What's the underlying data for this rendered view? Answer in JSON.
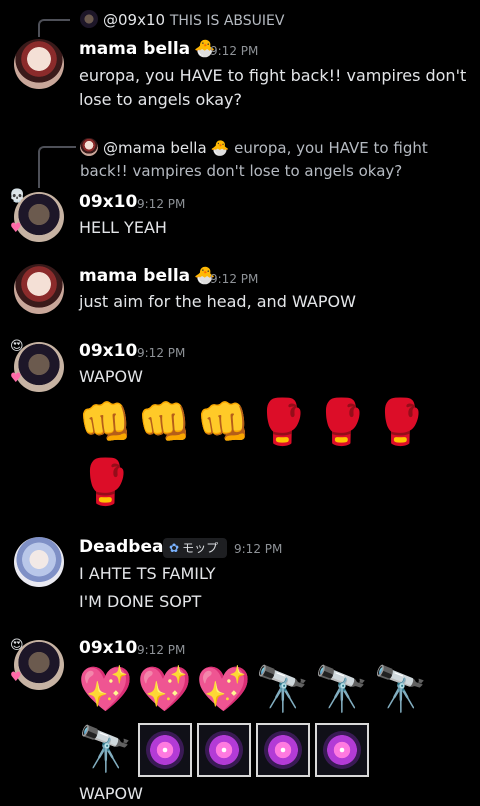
{
  "messages": [
    {
      "reply": {
        "author": "@09x10",
        "text": "THIS IS ABSUIEV"
      },
      "author": "mama bella",
      "badge": "🐣",
      "time": "9:12 PM",
      "lines": [
        "europa, you HAVE to fight back!! vampires don't",
        "lose to angels okay?"
      ]
    },
    {
      "reply": {
        "author": "@mama bella",
        "badge": "🐣",
        "text_line1": "europa, you HAVE to fight",
        "text_line2": "back!! vampires don't lose to angels okay?"
      },
      "author": "09x10",
      "time": "9:12 PM",
      "lines": [
        "HELL YEAH"
      ]
    },
    {
      "author": "mama bella",
      "badge": "🐣",
      "time": "9:12 PM",
      "lines": [
        "just aim for the head, and WAPOW"
      ]
    },
    {
      "author": "09x10",
      "time": "9:12 PM",
      "lines": [
        "WAPOW"
      ],
      "emoji_row1": [
        "👊",
        "👊",
        "👊",
        "🥊",
        "🥊",
        "🥊"
      ],
      "emoji_row2": [
        "🥊"
      ]
    },
    {
      "author": "Deadbeat",
      "role": {
        "icon": "✿",
        "label": "モップ"
      },
      "time": "9:12 PM",
      "lines": [
        "I AHTE TS FAMILY",
        "I'M DONE SOPT"
      ]
    },
    {
      "author": "09x10",
      "time": "9:12 PM",
      "emoji_row1": [
        "💖",
        "💖",
        "💖",
        "🔭",
        "🔭",
        "🔭"
      ],
      "emoji_row2": [
        "🔭",
        "🎆",
        "🎆",
        "🎆",
        "🎆"
      ],
      "lines": [
        "WAPOW"
      ]
    }
  ],
  "avatar_decor": {
    "skull": "💀",
    "heart": "♥"
  },
  "icons": {
    "avatar_mama": "avatar-mama-bella",
    "avatar_09": "avatar-09x10",
    "avatar_dead": "avatar-deadbeat",
    "fireworks": "fireworks-icon"
  }
}
